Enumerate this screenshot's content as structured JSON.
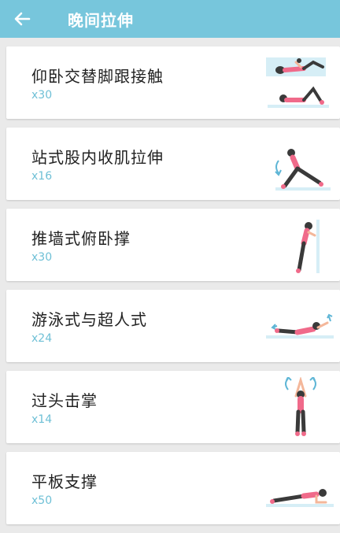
{
  "header": {
    "title": "晚间拉伸",
    "back_icon": "arrow-left-icon"
  },
  "colors": {
    "accent": "#77c6dc",
    "count": "#6fc0d6",
    "pink": "#f06a8a"
  },
  "exercises": [
    {
      "name": "仰卧交替脚跟接触",
      "count": "x30",
      "icon": "supine-heel-touch-illustration"
    },
    {
      "name": "站式股内收肌拉伸",
      "count": "x16",
      "icon": "standing-adductor-stretch-illustration"
    },
    {
      "name": "推墙式俯卧撑",
      "count": "x30",
      "icon": "wall-pushup-illustration"
    },
    {
      "name": "游泳式与超人式",
      "count": "x24",
      "icon": "swimmer-superman-illustration"
    },
    {
      "name": "过头击掌",
      "count": "x14",
      "icon": "overhead-clap-illustration"
    },
    {
      "name": "平板支撑",
      "count": "x50",
      "icon": "plank-illustration"
    }
  ]
}
